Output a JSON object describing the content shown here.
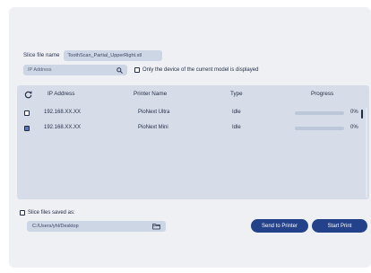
{
  "slice_file": {
    "label": "Slice file name",
    "value": "ToothScan_Partial_UpperRight.stl"
  },
  "search": {
    "placeholder": "IP Address",
    "icon": "search-icon"
  },
  "filter_option": {
    "label": "Only the device of the current model is displayed",
    "checked": false
  },
  "table": {
    "columns": [
      "IP Address",
      "Printer Name",
      "Type",
      "Progress"
    ],
    "rows": [
      {
        "checked": false,
        "ip": "192.168.XX.XX",
        "name": "PioNext Ultra",
        "type": "Idle",
        "progress": 0,
        "progress_label": "0%"
      },
      {
        "checked": true,
        "ip": "192.168.XX.XX",
        "name": "PioNext Mini",
        "type": "Idle",
        "progress": 0,
        "progress_label": "0%"
      }
    ]
  },
  "save": {
    "label": "Slice files saved as:",
    "checked": false,
    "path": "C:/Users/yhl/Desktop"
  },
  "buttons": {
    "send": "Send to Printer",
    "start": "Start Print"
  },
  "colors": {
    "accent": "#24428a",
    "field_bg": "#cdd6e4",
    "table_bg": "#d7dde8",
    "panel_bg": "#eef0f4"
  }
}
